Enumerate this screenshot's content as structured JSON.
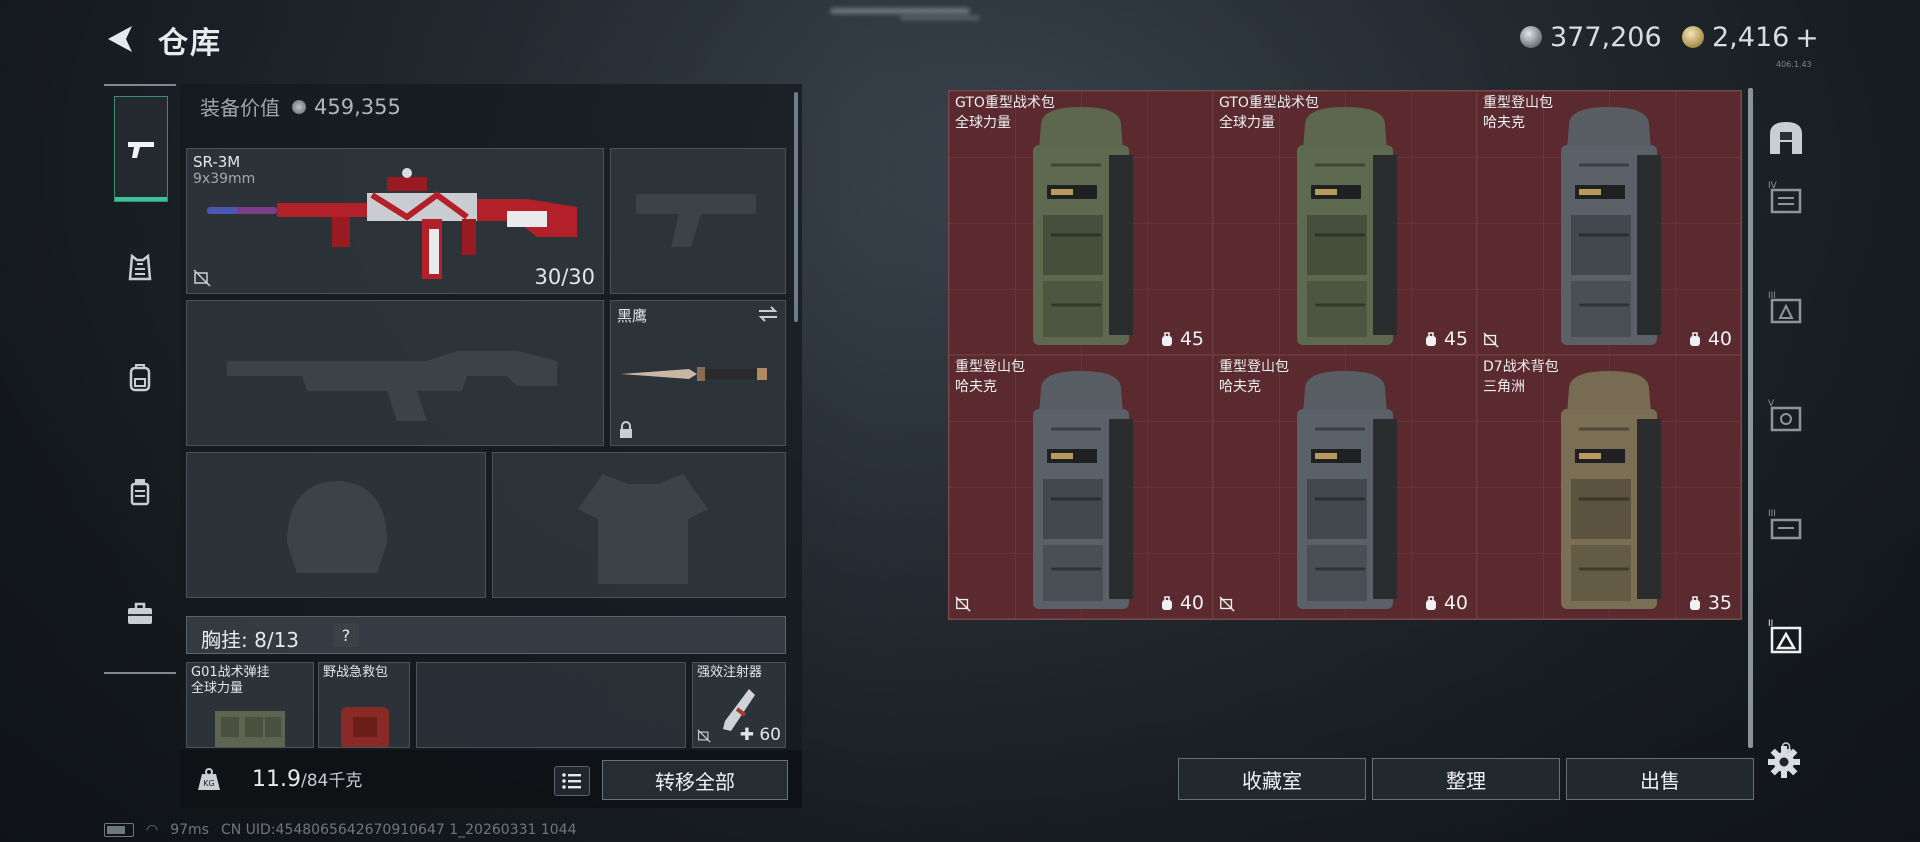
{
  "header": {
    "title": "仓库",
    "currency_silver": "377,206",
    "currency_gold": "2,416",
    "gold_plus": "+",
    "version": "406.1.43"
  },
  "left_nav": {
    "items": [
      {
        "name": "weapons",
        "icon": "pistol-icon",
        "active": true
      },
      {
        "name": "armor",
        "icon": "vest-icon",
        "active": false
      },
      {
        "name": "backpack",
        "icon": "backpack-icon",
        "active": false
      },
      {
        "name": "container",
        "icon": "jar-icon",
        "active": false
      },
      {
        "name": "tools",
        "icon": "toolbox-icon",
        "active": false
      }
    ]
  },
  "equipment": {
    "value_label": "装备价值",
    "value": "459,355",
    "primary_weapon": {
      "name": "SR-3M",
      "caliber": "9x39mm",
      "ammo": "30/30"
    },
    "melee": {
      "name": "黑鹰"
    },
    "chest_rig": {
      "label": "胸挂:",
      "count": "8/13",
      "help": "?"
    },
    "rig_item": {
      "line1": "G01战术弹挂",
      "line2": "全球力量"
    },
    "medkit": {
      "name": "野战急救包"
    },
    "injector": {
      "name": "强效注射器",
      "value": "✚ 60"
    },
    "weight": {
      "value": "11.9",
      "unit": "/84千克"
    },
    "transfer_label": "转移全部"
  },
  "storage": {
    "items": [
      {
        "name": "GTO重型战术包",
        "maker": "全球力量",
        "capacity": "45",
        "color": "#5e6a50",
        "locked": false
      },
      {
        "name": "GTO重型战术包",
        "maker": "全球力量",
        "capacity": "45",
        "color": "#5e6a50",
        "locked": false
      },
      {
        "name": "重型登山包",
        "maker": "哈夫克",
        "capacity": "40",
        "color": "#5a6168",
        "locked": true
      },
      {
        "name": "重型登山包",
        "maker": "哈夫克",
        "capacity": "40",
        "color": "#5a6168",
        "locked": true
      },
      {
        "name": "重型登山包",
        "maker": "哈夫克",
        "capacity": "40",
        "color": "#5a6168",
        "locked": true
      },
      {
        "name": "D7战术背包",
        "maker": "三角洲",
        "capacity": "35",
        "color": "#7a6f55",
        "locked": false
      }
    ]
  },
  "actions": {
    "collection": "收藏室",
    "sort": "整理",
    "sell": "出售"
  },
  "status_bar": {
    "ping": "97ms",
    "uid": "CN UID:4548065642670910647 1_20260331 1044"
  },
  "colors": {
    "accent_green": "#3ac596",
    "storage_bg": "#5b2a2e",
    "weapon_red": "#b3202a"
  }
}
